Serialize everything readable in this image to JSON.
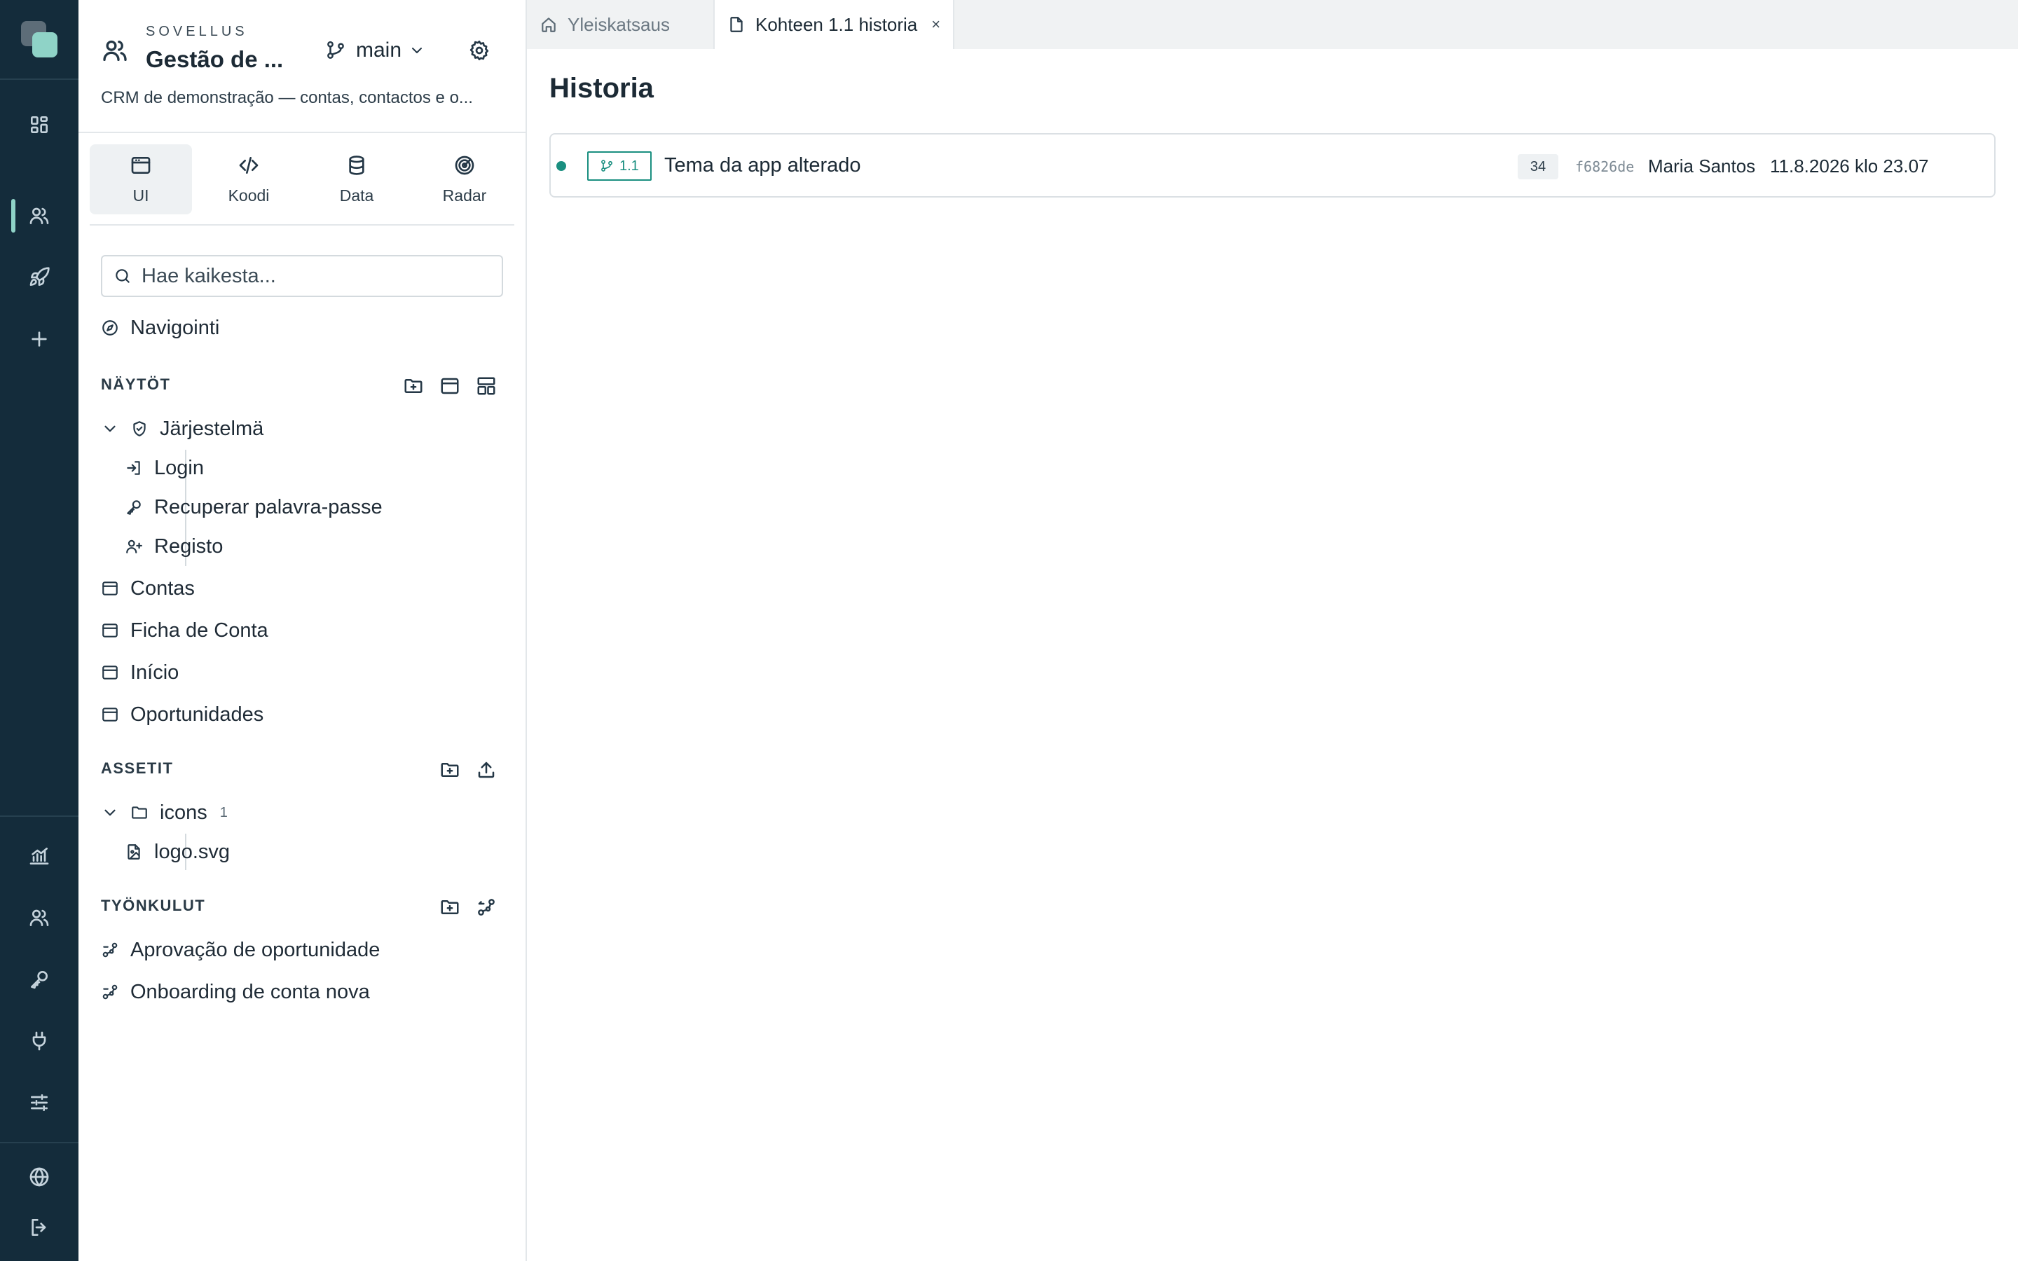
{
  "rail": {
    "top": [
      {
        "name": "rail-dashboard",
        "icon": "dashboard-icon"
      },
      {
        "name": "rail-apps",
        "icon": "users-icon",
        "active": true
      },
      {
        "name": "rail-deploy",
        "icon": "rocket-icon"
      },
      {
        "name": "rail-add",
        "icon": "plus-icon"
      }
    ],
    "bottom": [
      {
        "name": "rail-analytics",
        "icon": "chart-icon"
      },
      {
        "name": "rail-users",
        "icon": "users-icon"
      },
      {
        "name": "rail-keys",
        "icon": "key-icon"
      },
      {
        "name": "rail-integrations",
        "icon": "plug-icon"
      },
      {
        "name": "rail-settings",
        "icon": "sliders-icon"
      },
      {
        "name": "rail-language",
        "icon": "globe-icon"
      },
      {
        "name": "rail-logout",
        "icon": "logout-icon"
      }
    ]
  },
  "app": {
    "kicker": "SOVELLUS",
    "name": "Gestão de ...",
    "branch": "main",
    "description": "CRM de demonstração — contas, contactos e o..."
  },
  "modes": [
    {
      "label": "UI",
      "icon": "window-icon",
      "active": true
    },
    {
      "label": "Koodi",
      "icon": "code-icon"
    },
    {
      "label": "Data",
      "icon": "database-icon"
    },
    {
      "label": "Radar",
      "icon": "radar-icon"
    }
  ],
  "search": {
    "placeholder": "Hae kaikesta..."
  },
  "navigation": {
    "label": "Navigointi"
  },
  "screens": {
    "title": "NÄYTÖT",
    "group": "Järjestelmä",
    "group_items": [
      "Login",
      "Recuperar palavra-passe",
      "Registo"
    ],
    "items": [
      "Contas",
      "Ficha de Conta",
      "Início",
      "Oportunidades"
    ]
  },
  "assets": {
    "title": "ASSETIT",
    "folder": "icons",
    "folder_count": "1",
    "file": "logo.svg"
  },
  "workflows": {
    "title": "TYÖNKULUT",
    "items": [
      "Aprovação de oportunidade",
      "Onboarding de conta nova"
    ]
  },
  "tabs": {
    "overview": "Yleiskatsaus",
    "history": "Kohteen 1.1 historia",
    "close": "×"
  },
  "history": {
    "title": "Historia",
    "entries": [
      {
        "version": "1.1",
        "message": "Tema da app alterado",
        "count": "34",
        "hash": "f6826de",
        "author": "Maria Santos",
        "date": "11.8.2026 klo 23.07"
      }
    ]
  },
  "colors": {
    "rail_bg": "#142c3b",
    "accent": "#1a8f80",
    "logo_mint": "#8fd3c7"
  }
}
